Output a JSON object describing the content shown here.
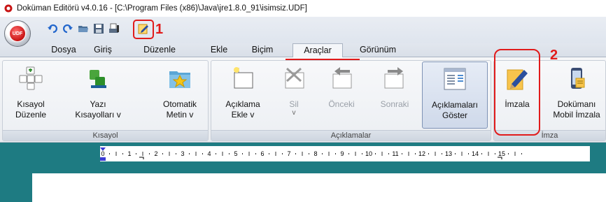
{
  "window": {
    "title": "Doküman Editörü v4.0.16 - [C:\\Program Files (x86)\\Java\\jre1.8.0_91\\isimsiz.UDF]",
    "app_icon": "app-logo-icon"
  },
  "app_button": {
    "label": "UDF",
    "icon": "udf-app-button-icon"
  },
  "quick_access": [
    {
      "name": "undo-icon"
    },
    {
      "name": "redo-icon"
    },
    {
      "name": "open-folder-icon"
    },
    {
      "name": "save-icon"
    },
    {
      "name": "print-settings-icon"
    },
    {
      "name": "sign-pen-icon"
    }
  ],
  "menu_tabs": [
    "Dosya",
    "Giriş",
    "Düzenle",
    "Ekle",
    "Biçim",
    "Araçlar",
    "Görünüm"
  ],
  "active_tab": "Araçlar",
  "ribbon": {
    "groups": [
      {
        "label": "Kısayol"
      },
      {
        "label": "Açıklamalar"
      },
      {
        "label": "İmza"
      }
    ],
    "buttons": {
      "kisayol_duzenle": {
        "line1": "Kısayol",
        "line2": "Düzenle",
        "icon": "shortcut-keys-icon"
      },
      "yazi_kisayollari": {
        "line1": "Yazı",
        "line2": "Kısayolları",
        "chevron": "v",
        "icon": "text-shortcuts-icon"
      },
      "otomatik_metin": {
        "line1": "Otomatik",
        "line2": "Metin",
        "chevron": "v",
        "icon": "auto-text-folder-icon"
      },
      "aciklama_ekle": {
        "line1": "Açıklama",
        "line2": "Ekle",
        "chevron": "v",
        "icon": "add-comment-icon"
      },
      "sil": {
        "line1": "Sil",
        "line2": "",
        "chevron": "v",
        "icon": "delete-comment-icon"
      },
      "onceki": {
        "line1": "Önceki",
        "line2": "",
        "icon": "previous-comment-icon"
      },
      "sonraki": {
        "line1": "Sonraki",
        "line2": "",
        "icon": "next-comment-icon"
      },
      "aciklamalari_goster": {
        "line1": "Açıklamaları",
        "line2": "Göster",
        "icon": "show-comments-icon"
      },
      "imzala": {
        "line1": "İmzala",
        "line2": "",
        "icon": "sign-document-icon"
      },
      "dokumani_mobil_imzala": {
        "line1": "Dokümanı",
        "line2": "Mobil İmzala",
        "icon": "mobile-sign-icon"
      }
    }
  },
  "ruler": {
    "numbers": [
      "1",
      "2",
      "3",
      "4",
      "5",
      "6",
      "7",
      "8",
      "9",
      "10",
      "11",
      "12",
      "13",
      "14",
      "15"
    ],
    "start": "0"
  },
  "annotations": {
    "first": "1",
    "second": "2"
  },
  "colors": {
    "annotation": "#e11b1b",
    "workspace": "#1e7b82",
    "ribbon_selected": "#cfd9ea"
  }
}
